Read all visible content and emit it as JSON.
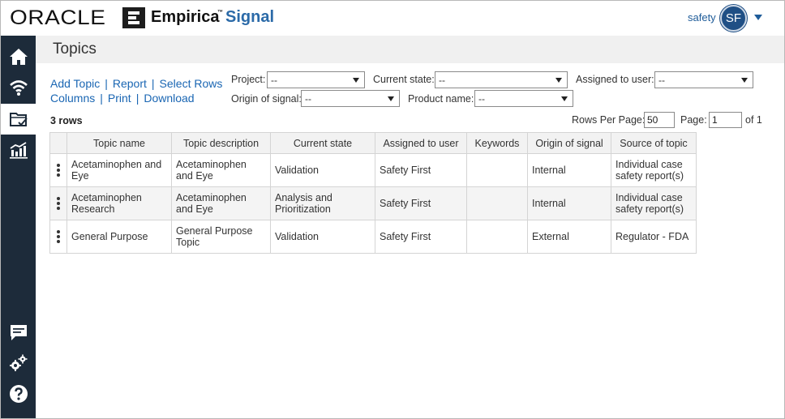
{
  "brand": {
    "oracle": "ORACLE",
    "empirica": "Empirica",
    "tm": "™",
    "signal": "Signal"
  },
  "user": {
    "name": "safety",
    "initials": "SF"
  },
  "sidebar": [
    {
      "icon": "home-icon"
    },
    {
      "icon": "signal-wifi-icon"
    },
    {
      "icon": "topics-folder-icon",
      "active": true
    },
    {
      "icon": "bar-chart-icon"
    },
    {
      "icon": "chat-icon"
    },
    {
      "icon": "settings-gears-icon"
    },
    {
      "icon": "help-icon"
    }
  ],
  "page": {
    "title": "Topics"
  },
  "actions": {
    "add_topic": "Add Topic",
    "report": "Report",
    "select_rows": "Select Rows",
    "columns": "Columns",
    "print": "Print",
    "download": "Download",
    "separator": "|"
  },
  "filters": {
    "project": {
      "label": "Project:",
      "value": "--"
    },
    "current_state": {
      "label": "Current state:",
      "value": "--"
    },
    "assigned_to_user": {
      "label": "Assigned to user:",
      "value": "--"
    },
    "origin_of_signal": {
      "label": "Origin of signal:",
      "value": "--"
    },
    "product_name": {
      "label": "Product name:",
      "value": "--"
    }
  },
  "summary": {
    "rows": "3 rows"
  },
  "pager": {
    "rows_per_page_label": "Rows Per Page:",
    "rows_per_page": "50",
    "page_label": "Page:",
    "page": "1",
    "of_label": "of 1"
  },
  "table": {
    "headers": [
      "Topic name",
      "Topic description",
      "Current state",
      "Assigned to user",
      "Keywords",
      "Origin of signal",
      "Source of topic"
    ],
    "rows": [
      [
        "Acetaminophen and Eye",
        "Acetaminophen and Eye",
        "Validation",
        "Safety First",
        "",
        "Internal",
        "Individual case safety report(s)"
      ],
      [
        "Acetaminophen Research",
        "Acetaminophen and Eye",
        "Analysis and Prioritization",
        "Safety First",
        "",
        "Internal",
        "Individual case safety report(s)"
      ],
      [
        "General Purpose",
        "General Purpose Topic",
        "Validation",
        "Safety First",
        "",
        "External",
        "Regulator - FDA"
      ]
    ]
  },
  "colors": {
    "sidebar": "#1d2b3a",
    "link": "#1a66b3",
    "signal": "#2b6aa8",
    "avatar": "#1f4f85"
  }
}
